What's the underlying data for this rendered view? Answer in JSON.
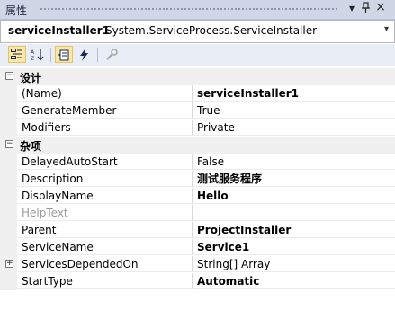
{
  "panel": {
    "title": "属性",
    "buttons": {
      "dropdown": "▾",
      "pin": "ᵒ",
      "close": "×"
    }
  },
  "selector": {
    "object_name": "serviceInstaller1",
    "object_type": "System.ServiceProcess.ServiceInstaller",
    "arrow": "▾"
  },
  "toolbar": {
    "categorized_icon": "categorized-icon",
    "alphabetical_icon": "alphabetical-icon",
    "properties_icon": "properties-icon",
    "events_icon": "events-icon",
    "property_pages_icon": "property-pages-icon",
    "active": "categorized"
  },
  "categories": [
    {
      "label": "设计",
      "expander": "−",
      "rows": [
        {
          "name": "(Name)",
          "value": "serviceInstaller1",
          "bold": true
        },
        {
          "name": "GenerateMember",
          "value": "True",
          "bold": false
        },
        {
          "name": "Modifiers",
          "value": "Private",
          "bold": false
        }
      ]
    },
    {
      "label": "杂项",
      "expander": "−",
      "rows": [
        {
          "name": "DelayedAutoStart",
          "value": "False",
          "bold": false
        },
        {
          "name": "Description",
          "value": "测试服务程序",
          "bold": true
        },
        {
          "name": "DisplayName",
          "value": "Hello",
          "bold": true
        },
        {
          "name": "HelpText",
          "value": "",
          "bold": false,
          "disabled": true
        },
        {
          "name": "Parent",
          "value": "ProjectInstaller",
          "bold": true
        },
        {
          "name": "ServiceName",
          "value": "Service1",
          "bold": true
        },
        {
          "name": "ServicesDependedOn",
          "value": "String[] Array",
          "bold": false,
          "expander": "+"
        },
        {
          "name": "StartType",
          "value": "Automatic",
          "bold": true
        }
      ]
    }
  ]
}
